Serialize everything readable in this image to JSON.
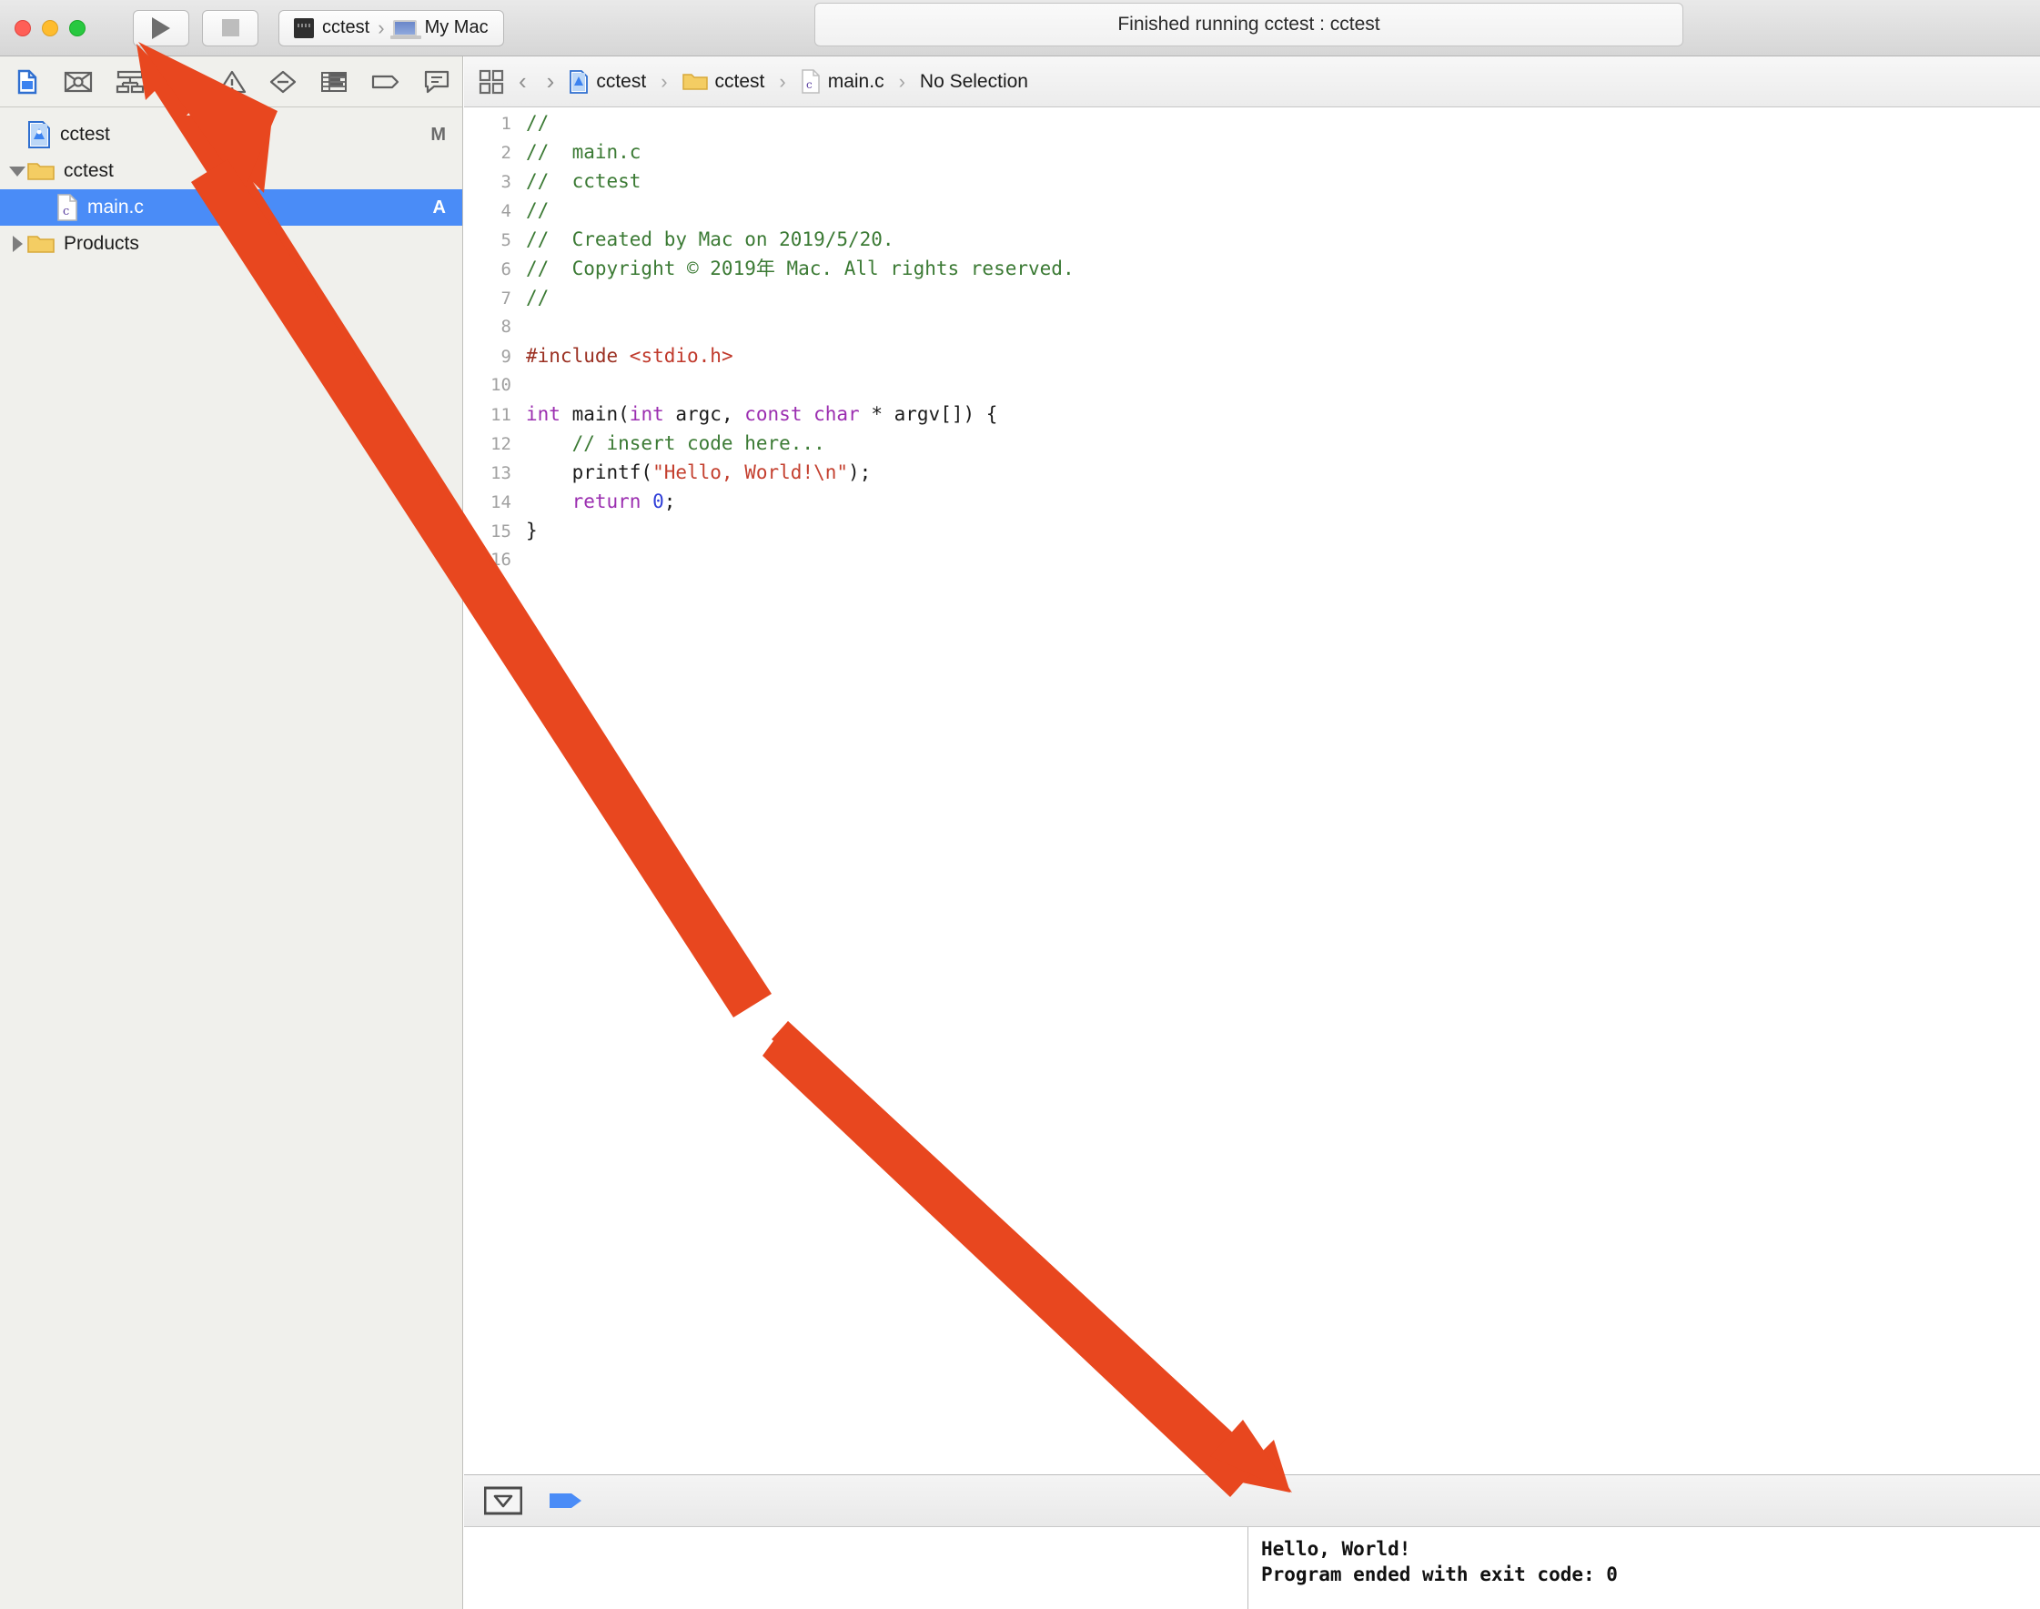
{
  "titlebar": {
    "run_label": "Run",
    "stop_label": "Stop",
    "scheme_name": "cctest",
    "destination_name": "My Mac",
    "scheme_separator": "›",
    "status_text": "Finished running cctest : cctest"
  },
  "navigator": {
    "toolbar_icons": [
      {
        "name": "folder-navigator-icon",
        "title": "Show the Project navigator"
      },
      {
        "name": "source-control-navigator-icon",
        "title": "Show the Source Control navigator"
      },
      {
        "name": "symbol-navigator-icon",
        "title": "Show the Symbol navigator"
      },
      {
        "name": "find-navigator-icon",
        "title": "Show the Find navigator"
      },
      {
        "name": "issue-navigator-icon",
        "title": "Show the Issue navigator"
      },
      {
        "name": "test-navigator-icon",
        "title": "Show the Test navigator"
      },
      {
        "name": "debug-navigator-icon",
        "title": "Show the Debug navigator"
      },
      {
        "name": "breakpoint-navigator-icon",
        "title": "Show the Breakpoint navigator"
      },
      {
        "name": "report-navigator-icon",
        "title": "Show the Report navigator"
      }
    ],
    "tree": [
      {
        "label": "cctest",
        "icon": "xcode-project-icon",
        "depth": 1,
        "twisty": "none",
        "badge": "M",
        "selected": false
      },
      {
        "label": "cctest",
        "icon": "folder-icon",
        "depth": 1,
        "twisty": "down",
        "badge": "",
        "selected": false
      },
      {
        "label": "main.c",
        "icon": "c-file-icon",
        "depth": 3,
        "twisty": "none",
        "badge": "A",
        "selected": true
      },
      {
        "label": "Products",
        "icon": "folder-icon",
        "depth": 1,
        "twisty": "right",
        "badge": "",
        "selected": false
      }
    ]
  },
  "jumpbar": {
    "related_items_label": "Related Items",
    "back_label": "‹",
    "forward_label": "›",
    "separator": "›",
    "crumbs": [
      {
        "label": "cctest",
        "icon": "xcode-project-icon"
      },
      {
        "label": "cctest",
        "icon": "folder-icon"
      },
      {
        "label": "main.c",
        "icon": "c-file-icon"
      },
      {
        "label": "No Selection",
        "icon": "none"
      }
    ]
  },
  "editor": {
    "filename": "main.c",
    "lines": [
      {
        "n": "1",
        "tokens": [
          {
            "t": "//",
            "c": "cm"
          }
        ]
      },
      {
        "n": "2",
        "tokens": [
          {
            "t": "//  main.c",
            "c": "cm"
          }
        ]
      },
      {
        "n": "3",
        "tokens": [
          {
            "t": "//  cctest",
            "c": "cm"
          }
        ]
      },
      {
        "n": "4",
        "tokens": [
          {
            "t": "//",
            "c": "cm"
          }
        ]
      },
      {
        "n": "5",
        "tokens": [
          {
            "t": "//  Created by Mac on 2019/5/20.",
            "c": "cm"
          }
        ]
      },
      {
        "n": "6",
        "tokens": [
          {
            "t": "//  Copyright © 2019年 Mac. All rights reserved.",
            "c": "cm"
          }
        ]
      },
      {
        "n": "7",
        "tokens": [
          {
            "t": "//",
            "c": "cm"
          }
        ]
      },
      {
        "n": "8",
        "tokens": []
      },
      {
        "n": "9",
        "tokens": [
          {
            "t": "#include ",
            "c": "pp"
          },
          {
            "t": "<stdio.h>",
            "c": "hdr"
          }
        ]
      },
      {
        "n": "10",
        "tokens": []
      },
      {
        "n": "11",
        "tokens": [
          {
            "t": "int",
            "c": "kw"
          },
          {
            "t": " main(",
            "c": "pl"
          },
          {
            "t": "int",
            "c": "kw"
          },
          {
            "t": " argc, ",
            "c": "pl"
          },
          {
            "t": "const",
            "c": "kw"
          },
          {
            "t": " ",
            "c": "pl"
          },
          {
            "t": "char",
            "c": "kw"
          },
          {
            "t": " * argv[]) {",
            "c": "pl"
          }
        ]
      },
      {
        "n": "12",
        "tokens": [
          {
            "t": "    // insert code here...",
            "c": "cm"
          }
        ]
      },
      {
        "n": "13",
        "tokens": [
          {
            "t": "    printf(",
            "c": "pl"
          },
          {
            "t": "\"Hello, World!\\n\"",
            "c": "str"
          },
          {
            "t": ");",
            "c": "pl"
          }
        ]
      },
      {
        "n": "14",
        "tokens": [
          {
            "t": "    ",
            "c": "pl"
          },
          {
            "t": "return",
            "c": "kw"
          },
          {
            "t": " ",
            "c": "pl"
          },
          {
            "t": "0",
            "c": "num"
          },
          {
            "t": ";",
            "c": "pl"
          }
        ]
      },
      {
        "n": "15",
        "tokens": [
          {
            "t": "}",
            "c": "pl"
          }
        ]
      },
      {
        "n": "16",
        "tokens": []
      }
    ]
  },
  "debugbar": {
    "toggle_console_label": "Hide/Show the Debug area",
    "step_label": "Continue program execution"
  },
  "console": {
    "lines": [
      "Hello, World!",
      "Program ended with exit code: 0"
    ]
  },
  "annotation": {
    "arrow_color": "#e8471f",
    "arrow1_label": "run-button-arrow",
    "arrow2_label": "console-output-arrow"
  },
  "colors": {
    "selection_blue": "#4a8cf7",
    "comment_green": "#3b7a34",
    "string_red": "#c4402f",
    "keyword_purple": "#9b2eb0",
    "number_blue": "#2f3ed8",
    "annotation_orange": "#e8471f"
  }
}
